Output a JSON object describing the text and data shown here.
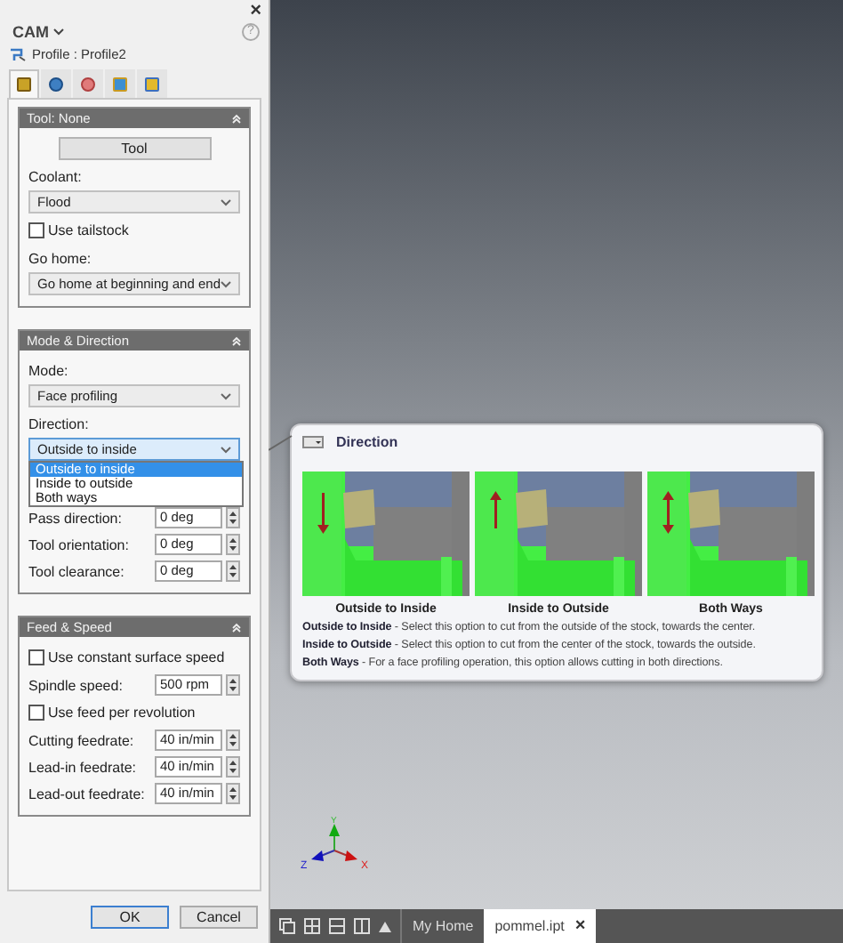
{
  "panel": {
    "close": "×",
    "title": "CAM",
    "breadcrumb": "Profile : Profile2",
    "help": "?",
    "tabs": [
      {
        "selected": true
      },
      {
        "selected": false
      },
      {
        "selected": false
      },
      {
        "selected": false
      },
      {
        "selected": false
      }
    ],
    "groups": [
      {
        "title": "Tool: None",
        "expanded": true,
        "items": [
          {
            "kind": "button",
            "label": "Tool"
          },
          {
            "kind": "label",
            "text": "Coolant:"
          },
          {
            "kind": "select",
            "value": "Flood"
          },
          {
            "kind": "checkbox",
            "label": "Use tailstock",
            "checked": false
          },
          {
            "kind": "label",
            "text": "Go home:"
          },
          {
            "kind": "select",
            "value": "Go home at beginning and end"
          }
        ]
      },
      {
        "title": "Mode & Direction",
        "expanded": true,
        "items": [
          {
            "kind": "label",
            "text": "Mode:"
          },
          {
            "kind": "select",
            "value": "Face profiling"
          },
          {
            "kind": "label",
            "text": "Direction:"
          },
          {
            "kind": "select",
            "value": "Outside to inside",
            "open": true,
            "options": [
              {
                "label": "Outside to inside",
                "selected": true
              },
              {
                "label": "Inside to outside",
                "selected": false
              },
              {
                "label": "Both ways",
                "selected": false
              }
            ]
          },
          {
            "kind": "spin",
            "label": "Pass direction:",
            "value": "0 deg"
          },
          {
            "kind": "spin",
            "label": "Tool orientation:",
            "value": "0 deg"
          },
          {
            "kind": "spin",
            "label": "Tool clearance:",
            "value": "0 deg"
          }
        ]
      },
      {
        "title": "Feed & Speed",
        "expanded": true,
        "items": [
          {
            "kind": "checkbox",
            "label": "Use constant surface speed",
            "checked": false
          },
          {
            "kind": "spin",
            "label": "Spindle speed:",
            "value": "500 rpm"
          },
          {
            "kind": "checkbox",
            "label": "Use feed per revolution",
            "checked": false
          },
          {
            "kind": "spin",
            "label": "Cutting feedrate:",
            "value": "40 in/min"
          },
          {
            "kind": "spin",
            "label": "Lead-in feedrate:",
            "value": "40 in/min"
          },
          {
            "kind": "spin",
            "label": "Lead-out feedrate:",
            "value": "40 in/min"
          }
        ]
      }
    ],
    "buttons": [
      {
        "label": "OK",
        "default": true
      },
      {
        "label": "Cancel",
        "default": false
      }
    ]
  },
  "tooltip": {
    "title": "Direction",
    "images": [
      {
        "caption": "Outside to Inside"
      },
      {
        "caption": "Inside to Outside"
      },
      {
        "caption": "Both Ways"
      }
    ],
    "descriptions": [
      "**Outside to Inside** - Select this option to cut from the outside of the stock, towards the center.",
      "**Inside to Outside** - Select this option to cut from the center of the stock, towards the outside.",
      "**Both Ways** - For a face profiling operation, this option allows cutting in both directions."
    ]
  },
  "viewport": {
    "axes": [
      "X",
      "Y",
      "Z"
    ],
    "document_tabs": [
      {
        "label": "My Home",
        "selected": false
      },
      {
        "label": "pommel.ipt",
        "selected": true,
        "close": "×"
      }
    ]
  }
}
